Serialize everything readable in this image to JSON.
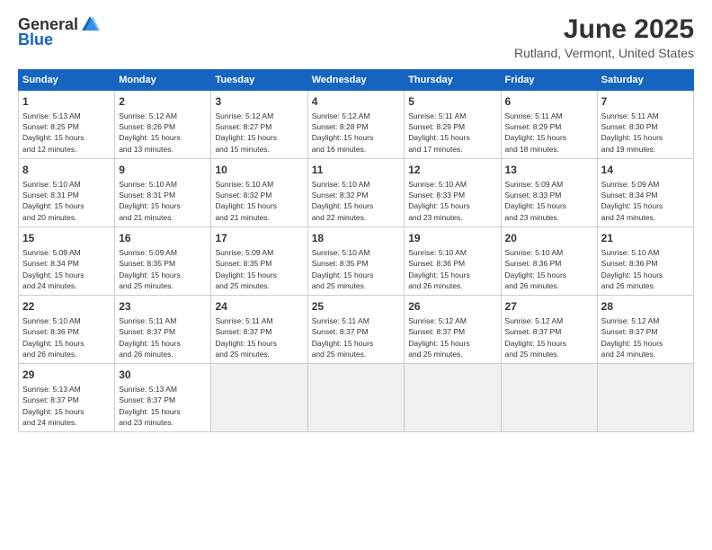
{
  "logo": {
    "general": "General",
    "blue": "Blue"
  },
  "header": {
    "title": "June 2025",
    "subtitle": "Rutland, Vermont, United States"
  },
  "calendar": {
    "days_of_week": [
      "Sunday",
      "Monday",
      "Tuesday",
      "Wednesday",
      "Thursday",
      "Friday",
      "Saturday"
    ],
    "weeks": [
      [
        {
          "day": "1",
          "info": "Sunrise: 5:13 AM\nSunset: 8:25 PM\nDaylight: 15 hours\nand 12 minutes."
        },
        {
          "day": "2",
          "info": "Sunrise: 5:12 AM\nSunset: 8:26 PM\nDaylight: 15 hours\nand 13 minutes."
        },
        {
          "day": "3",
          "info": "Sunrise: 5:12 AM\nSunset: 8:27 PM\nDaylight: 15 hours\nand 15 minutes."
        },
        {
          "day": "4",
          "info": "Sunrise: 5:12 AM\nSunset: 8:28 PM\nDaylight: 15 hours\nand 16 minutes."
        },
        {
          "day": "5",
          "info": "Sunrise: 5:11 AM\nSunset: 8:29 PM\nDaylight: 15 hours\nand 17 minutes."
        },
        {
          "day": "6",
          "info": "Sunrise: 5:11 AM\nSunset: 8:29 PM\nDaylight: 15 hours\nand 18 minutes."
        },
        {
          "day": "7",
          "info": "Sunrise: 5:11 AM\nSunset: 8:30 PM\nDaylight: 15 hours\nand 19 minutes."
        }
      ],
      [
        {
          "day": "8",
          "info": "Sunrise: 5:10 AM\nSunset: 8:31 PM\nDaylight: 15 hours\nand 20 minutes."
        },
        {
          "day": "9",
          "info": "Sunrise: 5:10 AM\nSunset: 8:31 PM\nDaylight: 15 hours\nand 21 minutes."
        },
        {
          "day": "10",
          "info": "Sunrise: 5:10 AM\nSunset: 8:32 PM\nDaylight: 15 hours\nand 21 minutes."
        },
        {
          "day": "11",
          "info": "Sunrise: 5:10 AM\nSunset: 8:32 PM\nDaylight: 15 hours\nand 22 minutes."
        },
        {
          "day": "12",
          "info": "Sunrise: 5:10 AM\nSunset: 8:33 PM\nDaylight: 15 hours\nand 23 minutes."
        },
        {
          "day": "13",
          "info": "Sunrise: 5:09 AM\nSunset: 8:33 PM\nDaylight: 15 hours\nand 23 minutes."
        },
        {
          "day": "14",
          "info": "Sunrise: 5:09 AM\nSunset: 8:34 PM\nDaylight: 15 hours\nand 24 minutes."
        }
      ],
      [
        {
          "day": "15",
          "info": "Sunrise: 5:09 AM\nSunset: 8:34 PM\nDaylight: 15 hours\nand 24 minutes."
        },
        {
          "day": "16",
          "info": "Sunrise: 5:09 AM\nSunset: 8:35 PM\nDaylight: 15 hours\nand 25 minutes."
        },
        {
          "day": "17",
          "info": "Sunrise: 5:09 AM\nSunset: 8:35 PM\nDaylight: 15 hours\nand 25 minutes."
        },
        {
          "day": "18",
          "info": "Sunrise: 5:10 AM\nSunset: 8:35 PM\nDaylight: 15 hours\nand 25 minutes."
        },
        {
          "day": "19",
          "info": "Sunrise: 5:10 AM\nSunset: 8:36 PM\nDaylight: 15 hours\nand 26 minutes."
        },
        {
          "day": "20",
          "info": "Sunrise: 5:10 AM\nSunset: 8:36 PM\nDaylight: 15 hours\nand 26 minutes."
        },
        {
          "day": "21",
          "info": "Sunrise: 5:10 AM\nSunset: 8:36 PM\nDaylight: 15 hours\nand 26 minutes."
        }
      ],
      [
        {
          "day": "22",
          "info": "Sunrise: 5:10 AM\nSunset: 8:36 PM\nDaylight: 15 hours\nand 26 minutes."
        },
        {
          "day": "23",
          "info": "Sunrise: 5:11 AM\nSunset: 8:37 PM\nDaylight: 15 hours\nand 26 minutes."
        },
        {
          "day": "24",
          "info": "Sunrise: 5:11 AM\nSunset: 8:37 PM\nDaylight: 15 hours\nand 25 minutes."
        },
        {
          "day": "25",
          "info": "Sunrise: 5:11 AM\nSunset: 8:37 PM\nDaylight: 15 hours\nand 25 minutes."
        },
        {
          "day": "26",
          "info": "Sunrise: 5:12 AM\nSunset: 8:37 PM\nDaylight: 15 hours\nand 25 minutes."
        },
        {
          "day": "27",
          "info": "Sunrise: 5:12 AM\nSunset: 8:37 PM\nDaylight: 15 hours\nand 25 minutes."
        },
        {
          "day": "28",
          "info": "Sunrise: 5:12 AM\nSunset: 8:37 PM\nDaylight: 15 hours\nand 24 minutes."
        }
      ],
      [
        {
          "day": "29",
          "info": "Sunrise: 5:13 AM\nSunset: 8:37 PM\nDaylight: 15 hours\nand 24 minutes."
        },
        {
          "day": "30",
          "info": "Sunrise: 5:13 AM\nSunset: 8:37 PM\nDaylight: 15 hours\nand 23 minutes."
        },
        {
          "day": "",
          "info": ""
        },
        {
          "day": "",
          "info": ""
        },
        {
          "day": "",
          "info": ""
        },
        {
          "day": "",
          "info": ""
        },
        {
          "day": "",
          "info": ""
        }
      ]
    ]
  }
}
